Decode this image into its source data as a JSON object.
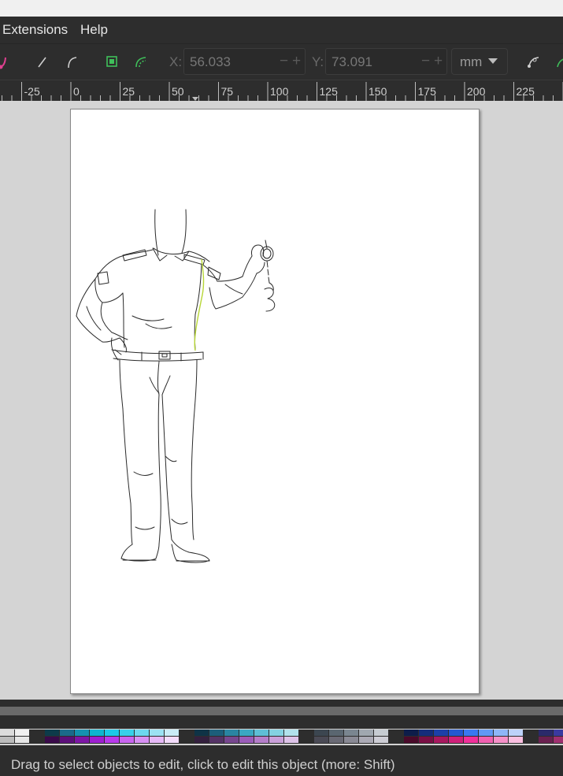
{
  "menubar": {
    "items": [
      "Extensions",
      "Help"
    ]
  },
  "toolbar": {
    "tools": [
      "bezier-icon",
      "line-segment-icon",
      "arc-segment-icon",
      "snap-bbox-icon",
      "offset-path-icon"
    ],
    "x": {
      "label": "X:",
      "value": "56.033"
    },
    "y": {
      "label": "Y:",
      "value": "73.091"
    },
    "unit": "mm",
    "spin_minus": "−",
    "spin_plus": "+"
  },
  "ruler": {
    "labels": [
      "-25",
      "0",
      "25",
      "50",
      "75",
      "100",
      "125",
      "150",
      "175",
      "200",
      "225"
    ]
  },
  "palette": {
    "top": [
      "#dcdcdc",
      "#f0f0f0",
      "#2d2d2d",
      "#0d3b4a",
      "#1a6a8a",
      "#1591b0",
      "#0fb5cf",
      "#1cc8e8",
      "#37d0ea",
      "#6cd8ef",
      "#9ce2f2",
      "#c9ecf6",
      "#2d2d2d",
      "#0f3346",
      "#1c5e7a",
      "#2a85a2",
      "#3aa7c2",
      "#5ebfd6",
      "#84d2e2",
      "#b1e2ec",
      "#2d2d2d",
      "#3c4650",
      "#5a6670",
      "#7a8690",
      "#a0a8b0",
      "#c6ccd2",
      "#2d2d2d",
      "#0d1d4a",
      "#142d7a",
      "#1c40a8",
      "#2458d0",
      "#3a78f0",
      "#6098f5",
      "#8eb6f8",
      "#bdd2fa",
      "#2d2d2d",
      "#2a2a6a",
      "#3a3aa0"
    ],
    "bottom": [
      "#bcbcbc",
      "#e6e6e6",
      "#2d2d2d",
      "#3a0a4a",
      "#5c0f7a",
      "#7d16a5",
      "#9e1fd0",
      "#b83aeb",
      "#c865ef",
      "#d790f3",
      "#e6b9f7",
      "#f3dcfb",
      "#2d2d2d",
      "#34203e",
      "#553366",
      "#77478f",
      "#9a5cb8",
      "#b47ec9",
      "#c9a0d9",
      "#ddc3e8",
      "#2d2d2d",
      "#4a4a55",
      "#6a6a75",
      "#8a8a95",
      "#abaab5",
      "#cdcdd5",
      "#2d2d2d",
      "#4a0a2a",
      "#7a0f45",
      "#a8185f",
      "#d0207a",
      "#f0309a",
      "#f060b0",
      "#f590c8",
      "#fabfe0",
      "#2d2d2d",
      "#6a2050",
      "#a03070"
    ]
  },
  "status": {
    "text": "Drag to select objects to edit, click to edit this object (more: Shift)"
  }
}
